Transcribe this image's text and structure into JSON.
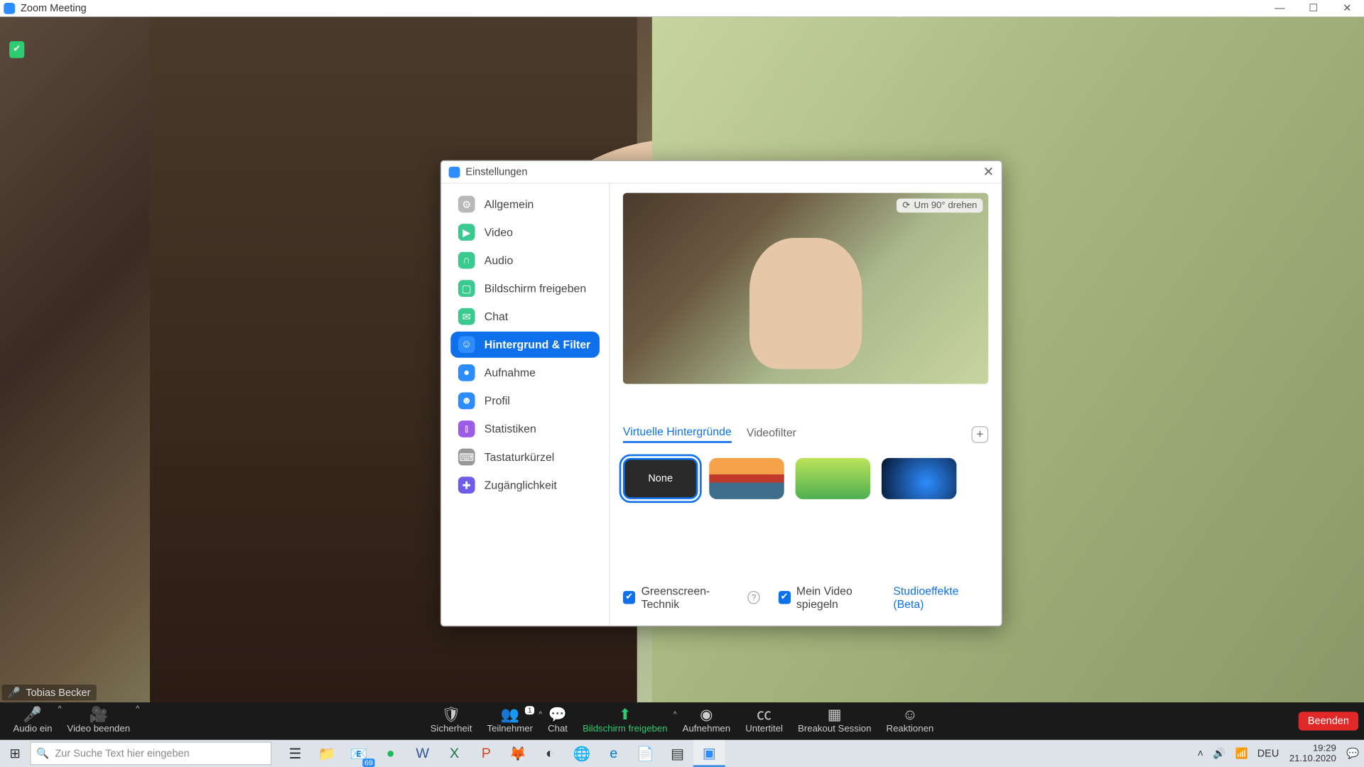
{
  "window": {
    "title": "Zoom Meeting"
  },
  "participant_name": "Tobias Becker",
  "settings": {
    "title": "Einstellungen",
    "nav": {
      "general": "Allgemein",
      "video": "Video",
      "audio": "Audio",
      "share": "Bildschirm freigeben",
      "chat": "Chat",
      "bgfilter": "Hintergrund & Filter",
      "record": "Aufnahme",
      "profile": "Profil",
      "stats": "Statistiken",
      "keyboard": "Tastaturkürzel",
      "access": "Zugänglichkeit"
    },
    "rotate_label": "Um 90° drehen",
    "tabs": {
      "vb": "Virtuelle Hintergründe",
      "vf": "Videofilter"
    },
    "none_label": "None",
    "greenscreen": "Greenscreen-Technik",
    "mirror": "Mein Video spiegeln",
    "studio": "Studioeffekte (Beta)"
  },
  "toolbar": {
    "audio": "Audio ein",
    "video": "Video beenden",
    "security": "Sicherheit",
    "participants": "Teilnehmer",
    "participants_count": "1",
    "chat": "Chat",
    "share": "Bildschirm freigeben",
    "record": "Aufnehmen",
    "cc": "Untertitel",
    "breakout": "Breakout Session",
    "reactions": "Reaktionen",
    "end": "Beenden"
  },
  "taskbar": {
    "search_placeholder": "Zur Suche Text hier eingeben",
    "mail_badge": "69",
    "lang": "DEU",
    "time": "19:29",
    "date": "21.10.2020"
  }
}
